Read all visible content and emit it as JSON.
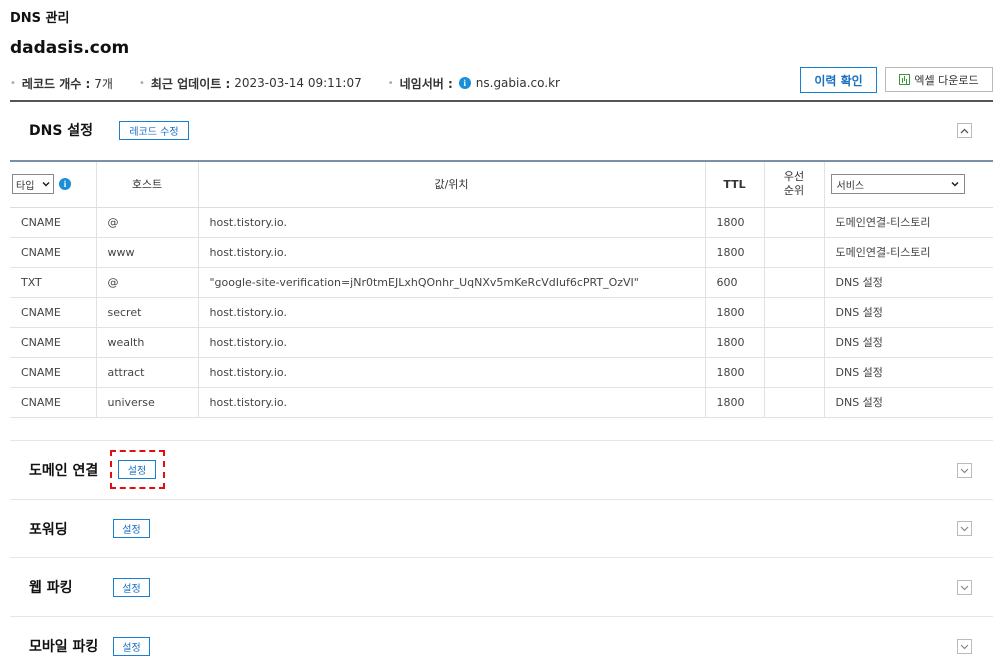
{
  "page": {
    "title": "DNS 관리",
    "domain": "dadasis.com"
  },
  "meta": {
    "record_count_label": "레코드 개수 :",
    "record_count_value": "7개",
    "updated_label": "최근 업데이트 :",
    "updated_value": "2023-03-14 09:11:07",
    "nameserver_label": "네임서버 :",
    "nameserver_value": "ns.gabia.co.kr"
  },
  "actions": {
    "history_label": "이력 확인",
    "excel_label": "엑셀 다운로드"
  },
  "dns_section": {
    "title": "DNS 설정",
    "edit_label": "레코드 수정",
    "columns": {
      "type_filter": "타입",
      "host": "호스트",
      "value": "값/위치",
      "ttl": "TTL",
      "priority": "우선\n순위",
      "service_filter": "서비스"
    },
    "records": [
      {
        "type": "CNAME",
        "host": "@",
        "value": "host.tistory.io.",
        "ttl": "1800",
        "priority": "",
        "service": "도메인연결-티스토리"
      },
      {
        "type": "CNAME",
        "host": "www",
        "value": "host.tistory.io.",
        "ttl": "1800",
        "priority": "",
        "service": "도메인연결-티스토리"
      },
      {
        "type": "TXT",
        "host": "@",
        "value": "\"google-site-verification=jNr0tmEJLxhQOnhr_UqNXv5mKeRcVdIuf6cPRT_OzVI\"",
        "ttl": "600",
        "priority": "",
        "service": "DNS 설정"
      },
      {
        "type": "CNAME",
        "host": "secret",
        "value": "host.tistory.io.",
        "ttl": "1800",
        "priority": "",
        "service": "DNS 설정"
      },
      {
        "type": "CNAME",
        "host": "wealth",
        "value": "host.tistory.io.",
        "ttl": "1800",
        "priority": "",
        "service": "DNS 설정"
      },
      {
        "type": "CNAME",
        "host": "attract",
        "value": "host.tistory.io.",
        "ttl": "1800",
        "priority": "",
        "service": "DNS 설정"
      },
      {
        "type": "CNAME",
        "host": "universe",
        "value": "host.tistory.io.",
        "ttl": "1800",
        "priority": "",
        "service": "DNS 설정"
      }
    ]
  },
  "sections": [
    {
      "title": "도메인 연결",
      "button": "설정"
    },
    {
      "title": "포워딩",
      "button": "설정"
    },
    {
      "title": "웹 파킹",
      "button": "설정"
    },
    {
      "title": "모바일 파킹",
      "button": "설정"
    }
  ],
  "colors": {
    "accent": "#1a7fd0",
    "highlight": "#e01010",
    "info": "#1a8fd8"
  }
}
